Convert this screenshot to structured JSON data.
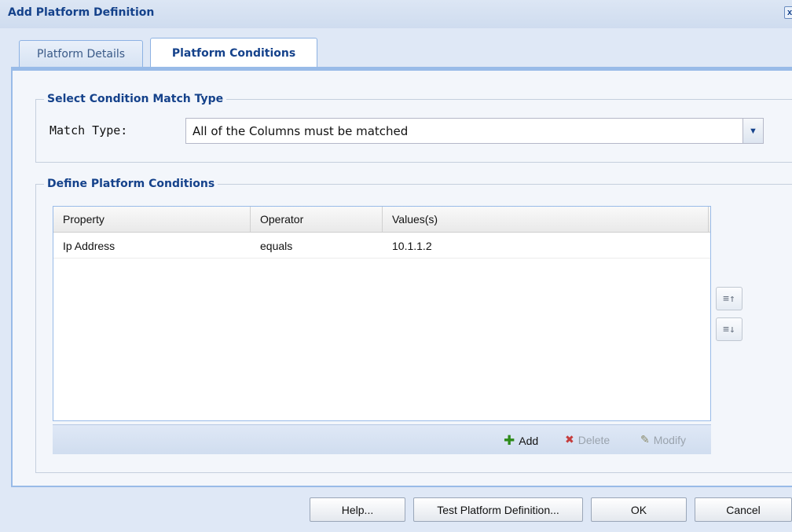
{
  "dialog": {
    "title": "Add Platform Definition",
    "close_label": "x"
  },
  "tabs": [
    {
      "label": "Platform Details",
      "active": false
    },
    {
      "label": "Platform Conditions",
      "active": true
    }
  ],
  "match_section": {
    "legend": "Select Condition Match Type",
    "label": "Match Type:",
    "selected": "All of the Columns must be matched"
  },
  "conditions_section": {
    "legend": "Define Platform Conditions",
    "columns": [
      "Property",
      "Operator",
      "Values(s)"
    ],
    "rows": [
      {
        "property": "Ip Address",
        "operator": "equals",
        "value": "10.1.1.2"
      }
    ],
    "toolbar": {
      "add": "Add",
      "delete": "Delete",
      "modify": "Modify"
    }
  },
  "footer": {
    "help": "Help...",
    "test": "Test Platform Definition...",
    "ok": "OK",
    "cancel": "Cancel"
  },
  "colors": {
    "title_text": "#15428b",
    "panel_border": "#99bbe8",
    "background": "#dfe8f6"
  }
}
